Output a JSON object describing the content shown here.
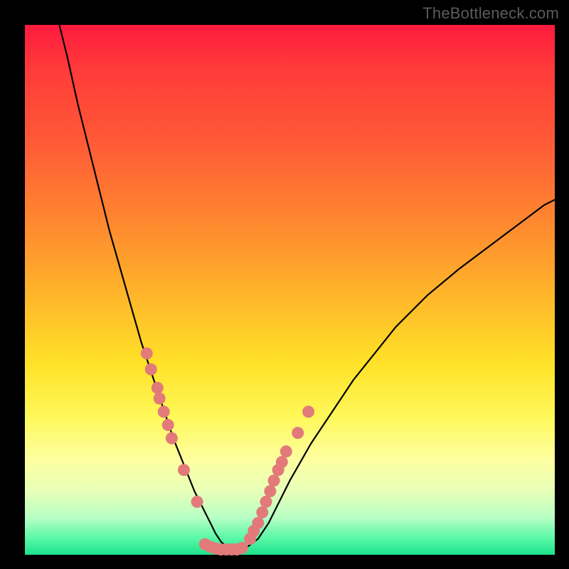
{
  "watermark": "TheBottleneck.com",
  "colors": {
    "curve_stroke": "#000000",
    "marker_fill": "#e27a7a",
    "marker_stroke": "#d56a6a"
  },
  "chart_data": {
    "type": "line",
    "title": "",
    "xlabel": "",
    "ylabel": "",
    "xlim": [
      0,
      100
    ],
    "ylim": [
      0,
      100
    ],
    "series": [
      {
        "name": "curve",
        "x": [
          6,
          8,
          10,
          12,
          14,
          16,
          18,
          20,
          22,
          24,
          26,
          28,
          30,
          32,
          33,
          34,
          35,
          36,
          37,
          38,
          39,
          40,
          42,
          44,
          46,
          48,
          50,
          54,
          58,
          62,
          66,
          70,
          76,
          82,
          90,
          98,
          100
        ],
        "y": [
          102,
          94,
          85,
          77,
          69,
          61,
          54,
          47,
          40,
          34,
          28,
          22,
          17,
          12,
          10,
          8,
          6,
          4,
          2.5,
          1.5,
          1,
          1,
          1.5,
          3,
          6,
          10,
          14,
          21,
          27,
          33,
          38,
          43,
          49,
          54,
          60,
          66,
          67
        ]
      }
    ],
    "markers": [
      {
        "x": 23.0,
        "y": 38.0
      },
      {
        "x": 23.8,
        "y": 35.0
      },
      {
        "x": 25.0,
        "y": 31.5
      },
      {
        "x": 25.4,
        "y": 29.5
      },
      {
        "x": 26.2,
        "y": 27.0
      },
      {
        "x": 27.0,
        "y": 24.5
      },
      {
        "x": 27.7,
        "y": 22.0
      },
      {
        "x": 30.0,
        "y": 16.0
      },
      {
        "x": 32.5,
        "y": 10.0
      },
      {
        "x": 34.0,
        "y": 2.0
      },
      {
        "x": 35.0,
        "y": 1.5
      },
      {
        "x": 36.0,
        "y": 1.2
      },
      {
        "x": 37.0,
        "y": 1.0
      },
      {
        "x": 38.0,
        "y": 1.0
      },
      {
        "x": 39.0,
        "y": 1.0
      },
      {
        "x": 40.0,
        "y": 1.0
      },
      {
        "x": 41.0,
        "y": 1.3
      },
      {
        "x": 42.5,
        "y": 3.0
      },
      {
        "x": 43.2,
        "y": 4.5
      },
      {
        "x": 44.0,
        "y": 6.0
      },
      {
        "x": 44.8,
        "y": 8.0
      },
      {
        "x": 45.5,
        "y": 10.0
      },
      {
        "x": 46.3,
        "y": 12.0
      },
      {
        "x": 47.0,
        "y": 14.0
      },
      {
        "x": 47.8,
        "y": 16.0
      },
      {
        "x": 48.5,
        "y": 17.5
      },
      {
        "x": 49.3,
        "y": 19.5
      },
      {
        "x": 51.5,
        "y": 23.0
      },
      {
        "x": 53.5,
        "y": 27.0
      }
    ]
  }
}
